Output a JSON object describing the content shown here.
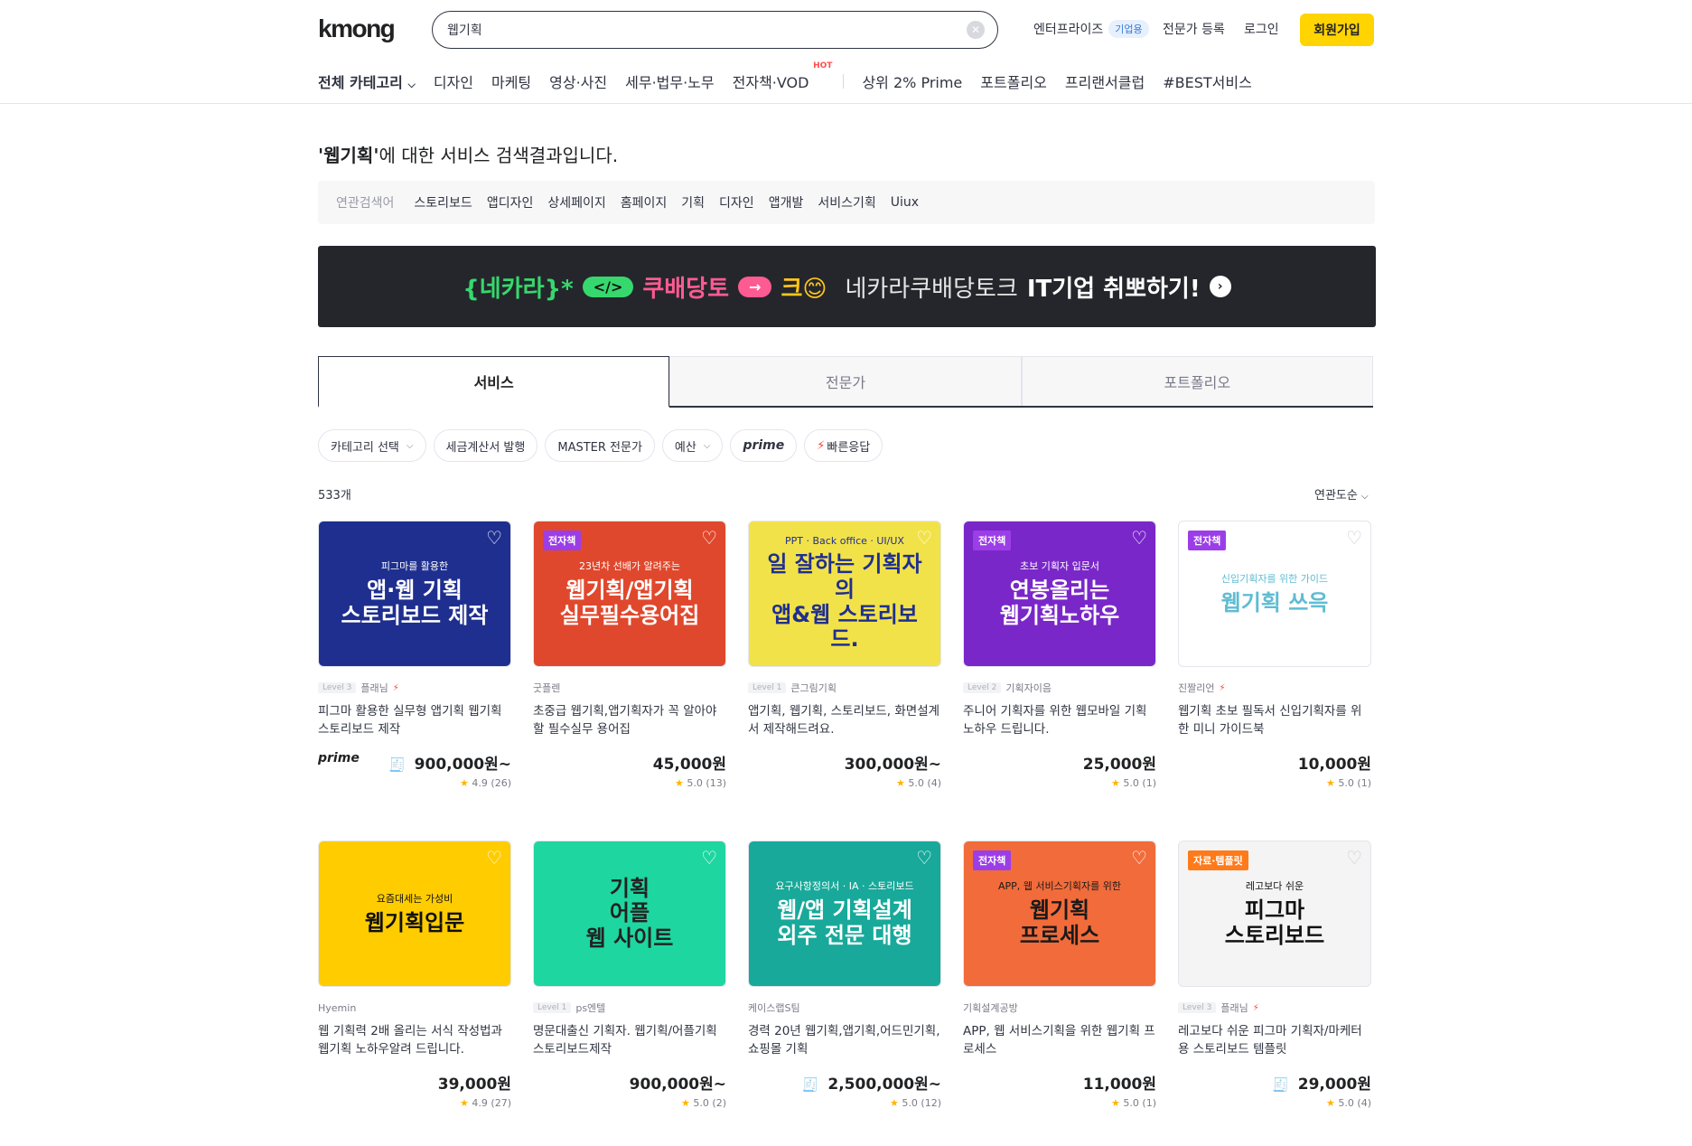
{
  "header": {
    "logo": "kmong",
    "search_value": "웹기획",
    "enterprise": "엔터프라이즈",
    "enterprise_badge": "기업용",
    "expert_register": "전문가 등록",
    "login": "로그인",
    "signup": "회원가입"
  },
  "categories": {
    "all": "전체 카테고리",
    "items": [
      "디자인",
      "마케팅",
      "영상·사진",
      "세무·법무·노무",
      "전자책·VOD"
    ],
    "hot": "HOT",
    "extra": [
      "상위 2% Prime",
      "포트폴리오",
      "프리랜서클럽",
      "#BEST서비스"
    ]
  },
  "result": {
    "query": "'웹기획'",
    "suffix": "에 대한 서비스 검색결과입니다.",
    "related_label": "연관검색어",
    "related": [
      "스토리보드",
      "앱디자인",
      "상세페이지",
      "홈페이지",
      "기획",
      "디자인",
      "앱개발",
      "서비스기획",
      "Uiux"
    ]
  },
  "banner": {
    "part1": "{네카라}*",
    "pill1": "</>",
    "part2": "쿠배당토",
    "pill2": "→",
    "part3": "크😊",
    "part4": "네카라쿠배당토크",
    "part5": "IT기업 취뽀하기!",
    "arrow": "›"
  },
  "tabs": [
    "서비스",
    "전문가",
    "포트폴리오"
  ],
  "filters": {
    "category": "카테고리 선택",
    "tax": "세금계산서 발행",
    "master": "MASTER 전문가",
    "budget": "예산",
    "prime": "prime",
    "fast": "빠른응답"
  },
  "count": "533개",
  "sort": "연관도순",
  "cards": [
    {
      "thumb_title": "앱·웹 기획\n스토리보드 제작",
      "thumb_sub": "피그마를 활용한",
      "level": "Level 3",
      "seller": "플래님",
      "bolt": "⚡",
      "title": "피그마 활용한 실무형 앱기획 웹기획 스토리보드 제작",
      "prime": "prime",
      "price": "900,000원~",
      "rating": "4.9",
      "reviews": "(26)",
      "bg": "#1f2f8f",
      "fg": "#ffffff"
    },
    {
      "thumb_title": "웹기획/앱기획\n실무필수용어집",
      "thumb_sub": "23년차 선배가 알려주는",
      "ebook": "전자책",
      "seller": "굿플렌",
      "title": "초중급 웹기획,앱기획자가 꼭 알아야 할 필수실무 용어집",
      "price": "45,000원",
      "rating": "5.0",
      "reviews": "(13)",
      "bg": "#e0482d",
      "fg": "#ffffff"
    },
    {
      "thumb_title": "일 잘하는 기획자의\n앱&웹 스토리보드.",
      "thumb_sub": "PPT · Back office · UI/UX",
      "level": "Level 1",
      "seller": "큰그림기획",
      "title": "앱기획, 웹기획, 스토리보드, 화면설계서 제작해드려요.",
      "price": "300,000원~",
      "rating": "5.0",
      "reviews": "(4)",
      "bg": "#f2e24a",
      "fg": "#1f2f8f"
    },
    {
      "thumb_title": "연봉올리는\n웹기획노하우",
      "thumb_sub": "초보 기획자 입문서",
      "ebook": "전자책",
      "level": "Level 2",
      "seller": "기획자이음",
      "title": "주니어 기획자를 위한 웹모바일 기획 노하우 드립니다.",
      "price": "25,000원",
      "rating": "5.0",
      "reviews": "(1)",
      "bg": "#7a27c9",
      "fg": "#ffffff"
    },
    {
      "thumb_title": "웹기획 쓰윽",
      "thumb_sub": "신입기획자를 위한 가이드",
      "ebook": "전자책",
      "seller": "진짤리언",
      "bolt": "⚡",
      "title": "웹기획 초보 필독서 신입기획자를 위한 미니 가이드북",
      "price": "10,000원",
      "rating": "5.0",
      "reviews": "(1)",
      "bg": "#ffffff",
      "fg": "#5fbcd3"
    },
    {
      "thumb_title": "웹기획입문",
      "thumb_sub": "요즘대세는 가성비",
      "seller": "Hyemin",
      "title": "웹 기획력 2배 올리는 서식 작성법과 웹기획 노하우알려 드립니다.",
      "price": "39,000원",
      "rating": "4.9",
      "reviews": "(27)",
      "bg": "#ffcc00",
      "fg": "#111111"
    },
    {
      "thumb_title": "기획\n어플\n웹 사이트",
      "thumb_sub": "",
      "level": "Level 1",
      "seller": "ps엔텔",
      "title": "명문대출신 기획자. 웹기획/어플기획 스토리보드제작",
      "price": "900,000원~",
      "rating": "5.0",
      "reviews": "(2)",
      "bg": "#1ed6a0",
      "fg": "#222222"
    },
    {
      "thumb_title": "웹/앱 기획설계\n외주 전문 대행",
      "thumb_sub": "요구사항정의서 · IA · 스토리보드",
      "seller": "케이스랩S팀",
      "title": "경력 20년 웹기획,앱기획,어드민기획, 쇼핑몰 기획",
      "price": "2,500,000원~",
      "receipt": "true",
      "rating": "5.0",
      "reviews": "(12)",
      "bg": "#18a99a",
      "fg": "#ffffff"
    },
    {
      "thumb_title": "웹기획\n프로세스",
      "thumb_sub": "APP, 웹 서비스기획자를 위한",
      "ebook": "전자책",
      "seller": "기획설계공방",
      "title": "APP, 웹 서비스기획을 위한 웹기획 프로세스",
      "price": "11,000원",
      "rating": "5.0",
      "reviews": "(1)",
      "bg": "#f26b3a",
      "fg": "#1a1a1a"
    },
    {
      "thumb_title": "피그마\n스토리보드",
      "thumb_sub": "레고보다 쉬운",
      "tag": "자료·템플릿",
      "level": "Level 3",
      "seller": "플래님",
      "bolt": "⚡",
      "title": "레고보다 쉬운 피그마 기획자/마케터용 스토리보드 템플릿",
      "price": "29,000원",
      "receipt": "true",
      "rating": "5.0",
      "reviews": "(4)",
      "bg": "#f4f4f4",
      "fg": "#111111"
    }
  ]
}
